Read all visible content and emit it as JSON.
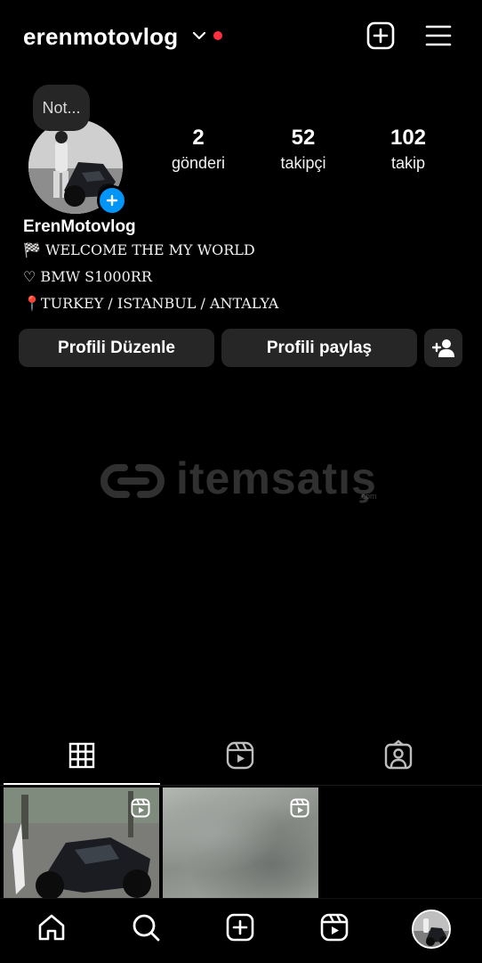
{
  "header": {
    "username": "erenmotovlog"
  },
  "note": {
    "text": "Not..."
  },
  "stats": {
    "posts": {
      "value": "2",
      "label": "gönderi"
    },
    "followers": {
      "value": "52",
      "label": "takipçi"
    },
    "following": {
      "value": "102",
      "label": "takip"
    }
  },
  "bio": {
    "display_name": "ErenMotovlog",
    "line1": "🏁 WELCOME THE MY WORLD",
    "line2": "♡ BMW S1000RR",
    "line3": "📍TURKEY / ISTANBUL / ANTALYA"
  },
  "buttons": {
    "edit_profile": "Profili Düzenle",
    "share_profile": "Profili paylaş"
  },
  "watermark": {
    "text": "itemsatış",
    "sub": ".com"
  },
  "tabs": {
    "active": "grid"
  },
  "colors": {
    "background": "#000000",
    "button": "#262626",
    "accent_blue": "#0095f6",
    "notification_red": "#ff3040"
  }
}
